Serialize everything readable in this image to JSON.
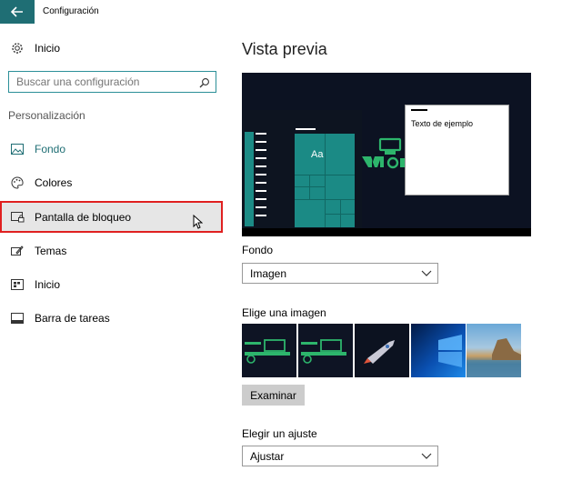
{
  "window": {
    "title": "Configuración"
  },
  "sidebar": {
    "home_label": "Inicio",
    "search_placeholder": "Buscar una configuración",
    "section_label": "Personalización",
    "items": [
      {
        "label": "Fondo",
        "icon": "image-icon",
        "active": true
      },
      {
        "label": "Colores",
        "icon": "palette-icon"
      },
      {
        "label": "Pantalla de bloqueo",
        "icon": "lock-screen-icon",
        "hovered": true
      },
      {
        "label": "Temas",
        "icon": "brush-icon"
      },
      {
        "label": "Inicio",
        "icon": "start-menu-icon"
      },
      {
        "label": "Barra de tareas",
        "icon": "taskbar-icon"
      }
    ]
  },
  "main": {
    "heading": "Vista previa",
    "preview": {
      "tile_label": "Aa",
      "window_text": "Texto de ejemplo"
    },
    "background_label": "Fondo",
    "background_value": "Imagen",
    "choose_image_label": "Elige una imagen",
    "browse_button": "Examinar",
    "fit_label": "Elegir un ajuste",
    "fit_value": "Ajustar"
  },
  "colors": {
    "accent": "#1f6e74",
    "tile": "#1b8a85",
    "highlight_border": "#e02020"
  }
}
